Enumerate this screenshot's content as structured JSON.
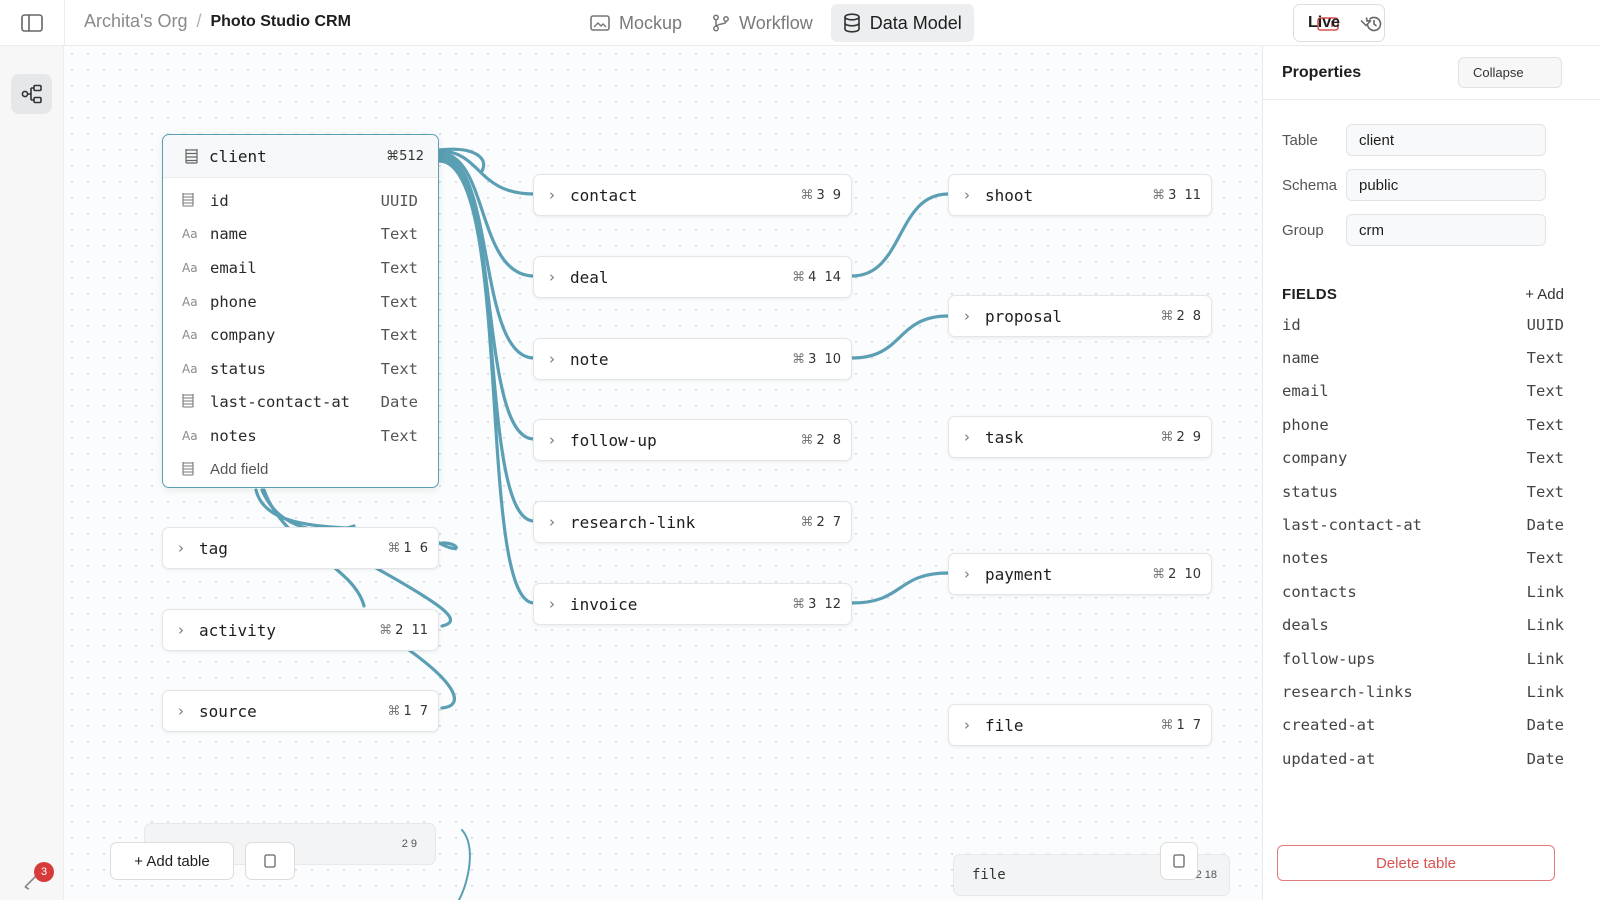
{
  "breadcrumb": {
    "org": "Archita's Org",
    "separator": "/",
    "project": "Photo Studio CRM"
  },
  "top_tabs": [
    {
      "label": "Mockup",
      "icon": "image-icon",
      "active": false
    },
    {
      "label": "Workflow",
      "icon": "branch-icon",
      "active": false
    },
    {
      "label": "Data Model",
      "icon": "database-icon",
      "active": true
    }
  ],
  "environment": {
    "selected": "Live"
  },
  "notifications": {
    "count": "3"
  },
  "client_table": {
    "name": "client",
    "count": "⌘512",
    "fields": [
      {
        "icon": "table-icon",
        "name": "id",
        "type": "UUID"
      },
      {
        "icon": "Aa",
        "name": "name",
        "type": "Text"
      },
      {
        "icon": "Aa",
        "name": "email",
        "type": "Text"
      },
      {
        "icon": "Aa",
        "name": "phone",
        "type": "Text"
      },
      {
        "icon": "Aa",
        "name": "company",
        "type": "Text"
      },
      {
        "icon": "Aa",
        "name": "status",
        "type": "Text"
      },
      {
        "icon": "table-icon",
        "name": "last-contact-at",
        "type": "Date"
      },
      {
        "icon": "Aa",
        "name": "notes",
        "type": "Text"
      }
    ],
    "add_field_label": "Add field"
  },
  "tables": [
    {
      "id": "tag",
      "name": "tag",
      "links": "1",
      "fields": "6"
    },
    {
      "id": "activity",
      "name": "activity",
      "links": "2",
      "fields": "11"
    },
    {
      "id": "source",
      "name": "source",
      "links": "1",
      "fields": "7"
    },
    {
      "id": "contact",
      "name": "contact",
      "links": "3",
      "fields": "9"
    },
    {
      "id": "deal",
      "name": "deal",
      "links": "4",
      "fields": "14"
    },
    {
      "id": "note",
      "name": "note",
      "links": "3",
      "fields": "10"
    },
    {
      "id": "follow-up",
      "name": "follow-up",
      "links": "2",
      "fields": "8"
    },
    {
      "id": "research-link",
      "name": "research-link",
      "links": "2",
      "fields": "7"
    },
    {
      "id": "invoice",
      "name": "invoice",
      "links": "3",
      "fields": "12"
    },
    {
      "id": "shoot",
      "name": "shoot",
      "links": "3",
      "fields": "11"
    },
    {
      "id": "proposal",
      "name": "proposal",
      "links": "2",
      "fields": "8"
    },
    {
      "id": "task",
      "name": "task",
      "links": "2",
      "fields": "9"
    },
    {
      "id": "payment",
      "name": "payment",
      "links": "2",
      "fields": "10"
    },
    {
      "id": "file",
      "name": "file",
      "links": "1",
      "fields": "7"
    }
  ],
  "ghost_nodes": [
    {
      "label": "",
      "count": "2 9"
    },
    {
      "label": "file",
      "count": "2 18"
    }
  ],
  "canvas_controls": {
    "add_table": "+ Add table"
  },
  "properties": {
    "title": "Properties",
    "collapse": "Collapse",
    "table_label": "Table",
    "table_value": "client",
    "schema_label": "Schema",
    "schema_value": "public",
    "group_label": "Group",
    "group_value": "crm",
    "fields_title": "FIELDS",
    "fields_add": "+ Add",
    "fields": [
      {
        "name": "id",
        "type": "UUID"
      },
      {
        "name": "name",
        "type": "Text"
      },
      {
        "name": "email",
        "type": "Text"
      },
      {
        "name": "phone",
        "type": "Text"
      },
      {
        "name": "company",
        "type": "Text"
      },
      {
        "name": "status",
        "type": "Text"
      },
      {
        "name": "last-contact-at",
        "type": "Date"
      },
      {
        "name": "notes",
        "type": "Text"
      },
      {
        "name": "contacts",
        "type": "Link"
      },
      {
        "name": "deals",
        "type": "Link"
      },
      {
        "name": "follow-ups",
        "type": "Link"
      },
      {
        "name": "research-links",
        "type": "Link"
      },
      {
        "name": "created-at",
        "type": "Date"
      },
      {
        "name": "updated-at",
        "type": "Date"
      }
    ],
    "delete": "Delete table"
  },
  "colors": {
    "edge": "#5b9fb4",
    "accent_border": "#5b9fb4",
    "danger": "#d8524f",
    "badge": "#d63b3b"
  }
}
